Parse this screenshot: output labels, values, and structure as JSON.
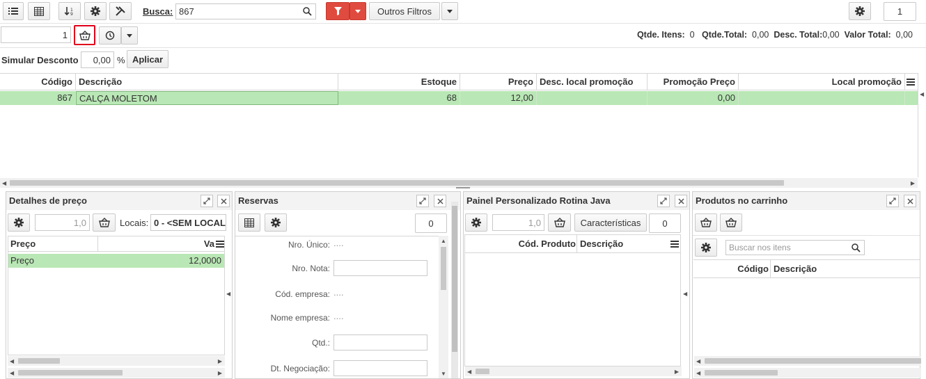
{
  "toolbar": {
    "search_label": "Busca:",
    "search_value": "867",
    "other_filters_label": "Outros Filtros",
    "page_number": "1"
  },
  "qty_row": {
    "qty_value": "1",
    "summary": {
      "qtde_itens_label": "Qtde. Itens:",
      "qtde_itens_value": "0",
      "qtde_total_label": "Qtde.Total:",
      "qtde_total_value": "0,00",
      "desc_total_label": "Desc. Total:",
      "desc_total_value": "0,00",
      "valor_total_label": "Valor Total:",
      "valor_total_value": "0,00"
    }
  },
  "discount": {
    "label": "Simular Desconto",
    "value": "0,00",
    "percent": "%",
    "apply_label": "Aplicar"
  },
  "grid": {
    "columns": [
      "Código",
      "Descrição",
      "Estoque",
      "Preço",
      "Desc. local promoção",
      "Promoção Preço",
      "Local promoção"
    ],
    "rows": [
      [
        "867",
        "CALÇA MOLETOM",
        "68",
        "12,00",
        "",
        "0,00",
        ""
      ]
    ]
  },
  "panels": {
    "price": {
      "title": "Detalhes de preço",
      "qty_value": "1,0",
      "locais_label": "Locais:",
      "locais_value": "0 - <SEM LOCAL",
      "col_preco": "Preço",
      "col_valor": "Va",
      "row_label": "Preço",
      "row_value": "12,0000"
    },
    "reservas": {
      "title": "Reservas",
      "count": "0",
      "fields": [
        "Nro. Único:",
        "Nro. Nota:",
        "Cód. empresa:",
        "Nome empresa:",
        "Qtd.:",
        "Dt. Negociação:"
      ]
    },
    "java": {
      "title": "Painel Personalizado Rotina Java",
      "qty_value": "1,0",
      "characteristics_label": "Características",
      "count": "0",
      "col_code": "Cód. Produto",
      "col_desc": "Descrição"
    },
    "cart": {
      "title": "Produtos no carrinho",
      "search_placeholder": "Buscar nos itens",
      "col_code": "Código",
      "col_desc": "Descrição"
    }
  },
  "colors": {
    "accent_red": "#e04b3f",
    "row_green": "#b9e7b5",
    "highlight_red": "#e0001b"
  },
  "icons": [
    "list-icon",
    "table-icon",
    "sort-icon",
    "gear-icon",
    "tools-icon",
    "search-icon",
    "filter-icon",
    "chevron-down-icon",
    "basket-icon",
    "clock-icon",
    "expand-icon",
    "close-icon",
    "menu-icon"
  ]
}
